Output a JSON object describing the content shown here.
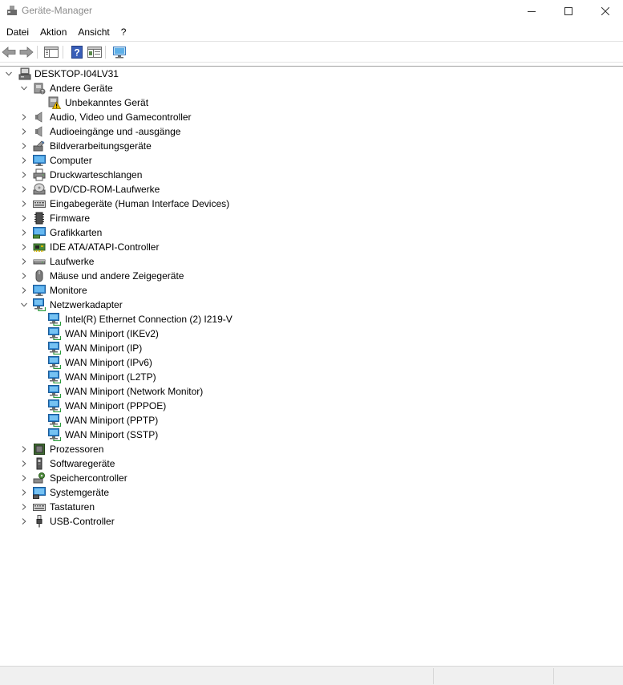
{
  "window": {
    "title": "Geräte-Manager"
  },
  "menu": [
    {
      "label": "Datei"
    },
    {
      "label": "Aktion"
    },
    {
      "label": "Ansicht"
    },
    {
      "label": "?"
    }
  ],
  "toolbar": {
    "buttons": [
      "back-icon",
      "forward-icon",
      "show-hide-console-tree-icon",
      "help-icon",
      "properties-icon",
      "scan-hardware-icon"
    ]
  },
  "tree": {
    "root": {
      "label": "DESKTOP-I04LV31",
      "icon": "computer-icon",
      "expanded": true
    },
    "categories": [
      {
        "label": "Andere Geräte",
        "icon": "unknown-device-category-icon",
        "expanded": true,
        "children": [
          {
            "label": "Unbekanntes Gerät",
            "icon": "warning-device-icon"
          }
        ]
      },
      {
        "label": "Audio, Video und Gamecontroller",
        "icon": "speaker-icon",
        "expanded": false
      },
      {
        "label": "Audioeingänge und -ausgänge",
        "icon": "speaker-icon",
        "expanded": false
      },
      {
        "label": "Bildverarbeitungsgeräte",
        "icon": "camera-icon",
        "expanded": false
      },
      {
        "label": "Computer",
        "icon": "monitor-icon",
        "expanded": false
      },
      {
        "label": "Druckwarteschlangen",
        "icon": "printer-icon",
        "expanded": false
      },
      {
        "label": "DVD/CD-ROM-Laufwerke",
        "icon": "disc-drive-icon",
        "expanded": false
      },
      {
        "label": "Eingabegeräte (Human Interface Devices)",
        "icon": "keyboard-icon",
        "expanded": false
      },
      {
        "label": "Firmware",
        "icon": "chip-icon",
        "expanded": false
      },
      {
        "label": "Grafikkarten",
        "icon": "display-adapter-icon",
        "expanded": false
      },
      {
        "label": "IDE ATA/ATAPI-Controller",
        "icon": "ide-controller-icon",
        "expanded": false
      },
      {
        "label": "Laufwerke",
        "icon": "disk-drive-icon",
        "expanded": false
      },
      {
        "label": "Mäuse und andere Zeigegeräte",
        "icon": "mouse-icon",
        "expanded": false
      },
      {
        "label": "Monitore",
        "icon": "monitor-icon",
        "expanded": false
      },
      {
        "label": "Netzwerkadapter",
        "icon": "network-adapter-icon",
        "expanded": true,
        "children": [
          {
            "label": "Intel(R) Ethernet Connection (2) I219-V",
            "icon": "network-adapter-icon"
          },
          {
            "label": "WAN Miniport (IKEv2)",
            "icon": "network-adapter-icon"
          },
          {
            "label": "WAN Miniport (IP)",
            "icon": "network-adapter-icon"
          },
          {
            "label": "WAN Miniport (IPv6)",
            "icon": "network-adapter-icon"
          },
          {
            "label": "WAN Miniport (L2TP)",
            "icon": "network-adapter-icon"
          },
          {
            "label": "WAN Miniport (Network Monitor)",
            "icon": "network-adapter-icon"
          },
          {
            "label": "WAN Miniport (PPPOE)",
            "icon": "network-adapter-icon"
          },
          {
            "label": "WAN Miniport (PPTP)",
            "icon": "network-adapter-icon"
          },
          {
            "label": "WAN Miniport (SSTP)",
            "icon": "network-adapter-icon"
          }
        ]
      },
      {
        "label": "Prozessoren",
        "icon": "processor-icon",
        "expanded": false
      },
      {
        "label": "Softwaregeräte",
        "icon": "software-device-icon",
        "expanded": false
      },
      {
        "label": "Speichercontroller",
        "icon": "storage-controller-icon",
        "expanded": false
      },
      {
        "label": "Systemgeräte",
        "icon": "system-device-icon",
        "expanded": false
      },
      {
        "label": "Tastaturen",
        "icon": "keyboard-icon",
        "expanded": false
      },
      {
        "label": "USB-Controller",
        "icon": "usb-icon",
        "expanded": false
      }
    ]
  }
}
